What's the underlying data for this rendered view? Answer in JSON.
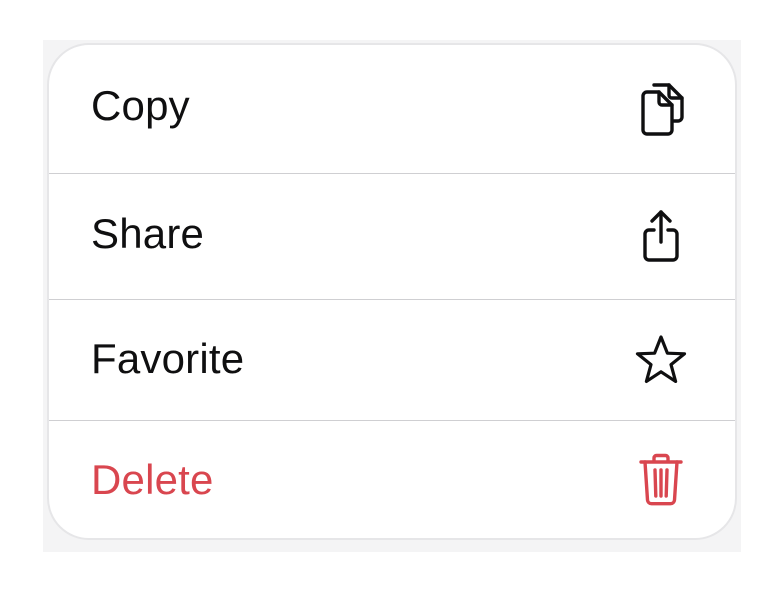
{
  "colors": {
    "text": "#0f0f10",
    "destructive": "#d9464f",
    "separator": "#cfcfd2",
    "menu_border": "#e6e6e8"
  },
  "menu": {
    "items": [
      {
        "label": "Copy",
        "icon": "copy-icon"
      },
      {
        "label": "Share",
        "icon": "share-icon"
      },
      {
        "label": "Favorite",
        "icon": "star-icon"
      },
      {
        "label": "Delete",
        "icon": "trash-icon",
        "destructive": true
      }
    ]
  }
}
